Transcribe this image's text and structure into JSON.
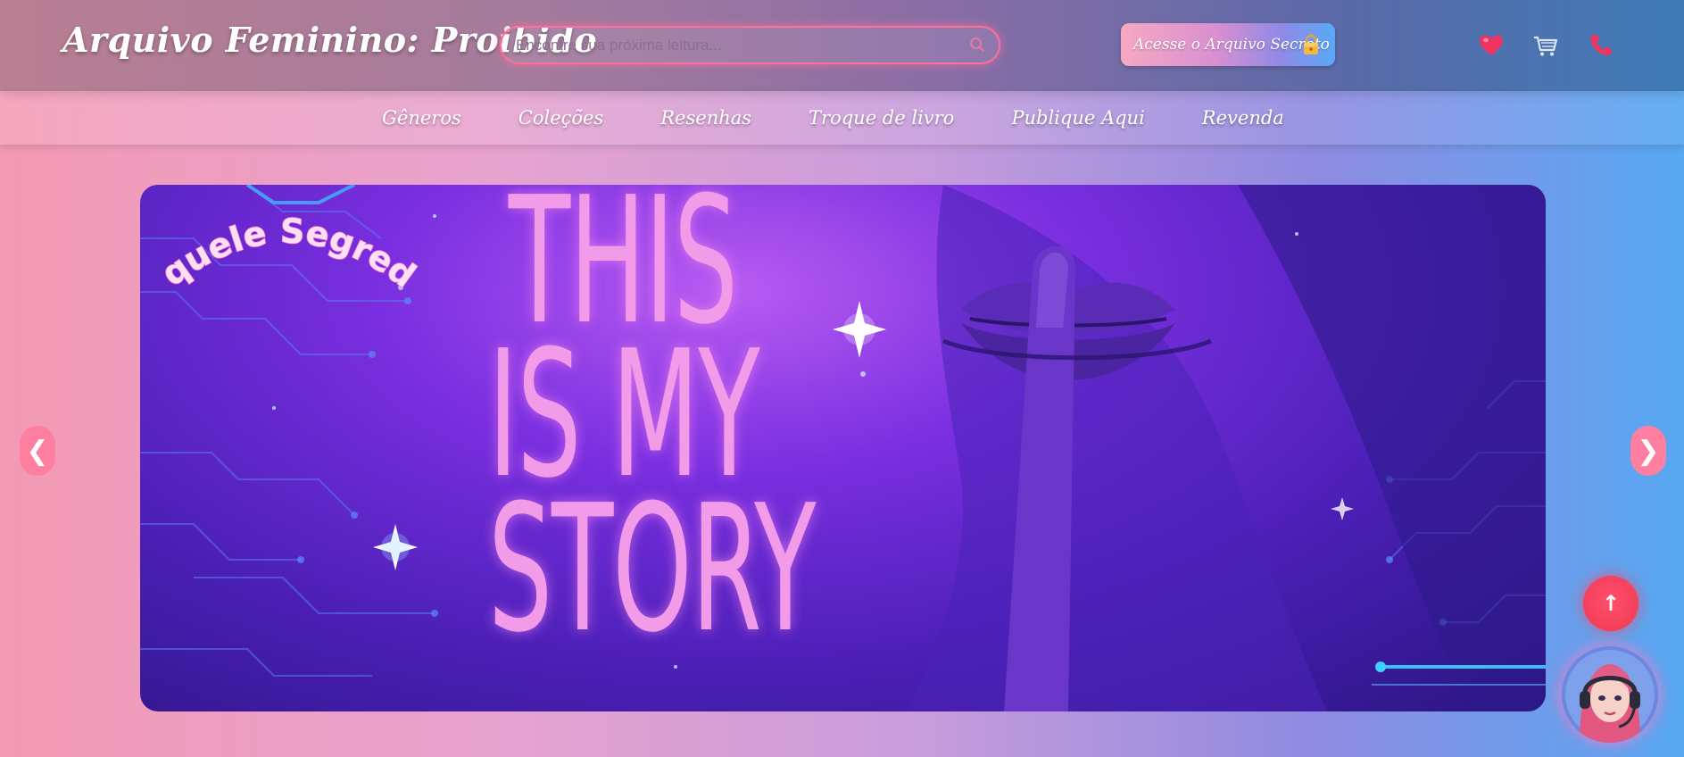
{
  "header": {
    "logo": "Arquivo Feminino: Proibido",
    "search": {
      "placeholder": "Encontre sua próxima leitura...",
      "value": ""
    },
    "secret_button": {
      "label": "Acesse o Arquivo Secreto",
      "icon": "lock-icon"
    },
    "icons": [
      "heart-icon",
      "cart-icon",
      "phone-icon"
    ]
  },
  "nav": {
    "items": [
      {
        "label": "Gêneros"
      },
      {
        "label": "Coleções"
      },
      {
        "label": "Resenhas"
      },
      {
        "label": "Troque de livro"
      },
      {
        "label": "Publique Aqui"
      },
      {
        "label": "Revenda"
      }
    ]
  },
  "banner": {
    "title_lines": [
      "THIS",
      "IS MY",
      "STORY"
    ],
    "subtitle": "Aquele Segredo"
  },
  "carousel": {
    "prev": "❮",
    "next": "❯"
  },
  "scroll_top": {
    "label": "↑"
  },
  "colors": {
    "accent_pink": "#ff6f9c",
    "banner_purple": "#7a2fe0",
    "title_pink": "#f29be8",
    "scroll_button": "#f0384f"
  }
}
